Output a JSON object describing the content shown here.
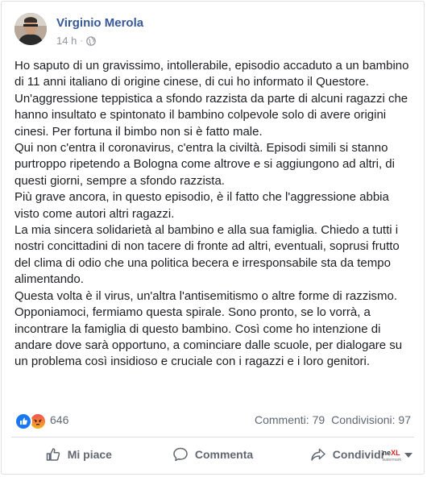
{
  "post": {
    "author": "Virginio Merola",
    "time": "14 h",
    "separator": "·",
    "paragraphs": [
      "Ho saputo di un gravissimo, intollerabile, episodio accaduto a un bambino di 11 anni italiano di origine cinese, di cui ho informato il Questore.",
      "Un'aggressione teppistica a sfondo razzista da parte di alcuni ragazzi che hanno insultato e spintonato il bambino colpevole solo di avere origini cinesi. Per fortuna il bimbo non si è fatto male.",
      "Qui non c'entra il coronavirus, c'entra la civiltà. Episodi simili si stanno purtroppo ripetendo a Bologna come altrove e si aggiungono ad altri, di questi giorni, sempre a sfondo razzista.",
      "Più grave ancora, in questo episodio, è il fatto che l'aggressione abbia visto come autori altri ragazzi.",
      "La mia sincera solidarietà al bambino e alla sua famiglia. Chiedo a tutti i nostri concittadini di non tacere di fronte ad altri, eventuali, soprusi frutto del clima di odio che una politica becera e irresponsabile sta da tempo alimentando.",
      "Questa volta è il virus, un'altra l'antisemitismo o altre forme di razzismo. Opponiamoci, fermiamo questa spirale. Sono pronto, se lo vorrà, a incontrare la famiglia di questo bambino. Così come ho intenzione di andare dove sarà opportuno, a cominciare dalle scuole, per dialogare su un problema così insidioso e cruciale con i ragazzi e i loro genitori."
    ]
  },
  "stats": {
    "reaction_count": "646",
    "comments": "Commenti: 79",
    "shares": "Condivisioni: 97",
    "reaction_icons": [
      "like-icon",
      "angry-icon"
    ]
  },
  "actions": {
    "like": "Mi piace",
    "comment": "Commenta",
    "share": "Condividi"
  },
  "brand": {
    "prefix": "ne",
    "accent": "XL",
    "sub": "watermark"
  },
  "colors": {
    "name_link": "#385898",
    "meta": "#90949c",
    "action_text": "#606770",
    "like_blue": "#1877f2"
  }
}
